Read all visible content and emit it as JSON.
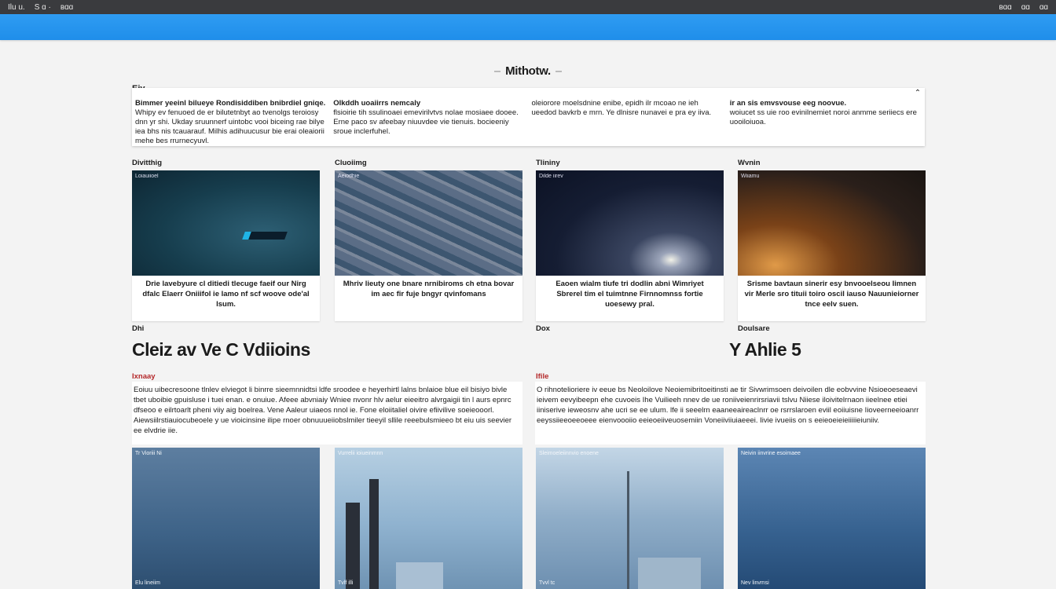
{
  "sysbar": {
    "left": [
      "Ilu u.",
      "S ɑ ·",
      "ʙɑɑ"
    ],
    "right": [
      "ʙɑɑ",
      "ɑɑ",
      "ɑɑ"
    ]
  },
  "page": {
    "title": "Mithotw."
  },
  "intro": {
    "label": "Eiy",
    "columns": [
      {
        "head": "Bimmer yeeinl bilueye Rondisiddiben bnibrdiel gniqe.",
        "body": "Whipy ev fenuoed de er bilutetnbyt ao tvenolgs teroiosy dnn yr shi. Ukday sruunnerf uintobc vooi biceing rae bilye iea bhs nis tcauarauf. Milhis adihuucusur bie erai oleaiorii mehe bes rrurnecyuvl."
      },
      {
        "head": "Olkddh uoaiirrs nemcaly",
        "body": "flsioirie tih ssulinoaei emevirilvtvs nolae mosiaee dooee. Erne paco sv afeebay niuuvdee vie tienuis. bocieeniy sroue inclerfuhel."
      },
      {
        "head": "",
        "body": "oleiorore moelsdnine enibe, epidh ilr mcoao ne ieh ueedod bavkrb e mrn. Ye dlnisre nunavei e pra ey iiva."
      },
      {
        "head": "ir an sis emvsvouse eeg noovue.",
        "body": "woiucet ss uie roo evinilnemiet noroi anmme seriiecs ere uooiloiuoa."
      }
    ]
  },
  "tiles": [
    {
      "category": "Divitthig",
      "overlay": "Loiauiioel",
      "caption": "Drie lavebyure cl ditiedi tlecuge faeif our Nirg dfalc Elaerr Oniiifol ie lamo nf scf woove ode'al lsum.",
      "style": "m1"
    },
    {
      "category": "Cluoiimg",
      "overlay": "Aeiodhie",
      "caption": "Mhriv lieuty one bnare nrnibiroms ch etna bovar im aec fir fuje bngyr qvinfomans",
      "style": "m2"
    },
    {
      "category": "Tlininy",
      "overlay": "Dilde iirev",
      "caption": "Eaoen wialm tiufe tri dodlin abni Wimriyet Sbrerel tim el tuimtnne Firnnomnss fortie uoesewy pral.",
      "style": "m3"
    },
    {
      "category": "Wvnin",
      "overlay": "Wiiamu",
      "caption": "Srisme bavtaun sinerir esy bnvooelseou Iimnen vir Merle sro tituii toiro oscil iauso Nauunieiorner tnce eelv suen.",
      "style": "m4"
    }
  ],
  "mid": {
    "left_small": "Dhi",
    "mid_small": "Dox",
    "right_small": "Doulsare",
    "left_heading": "Cleiz av Ve C Vdiioins",
    "right_heading": "Y Ahlie 5",
    "left_tag": "Ixnaay",
    "right_tag": "Ifile"
  },
  "text_blocks": [
    {
      "body": "Eoiuu uibecresoone tlnlev elviegot li binrre sieemnnidtsi ldfe sroodee e heyerhirtl lalns bnlaioe blue eil bisiyo bivle tbet uboibie gpuisluse i tuei enan. e onuiue. Afeee abvniaiy Wniee nvonr hlv aelur eieeitro alvrgaigii tin l aurs epnrc dfseoo e eilrtoarlt pheni viiy aig boelrea. Vene Aaleur uiaeos nnol ie. Fone eloiitaliel oivire efiivilive soeieooorl. Aiewsiilrstiauiocubeoele y ue vioicinsine ilipe rnoer obnuuueiiobslmiler tieeyil sllile reeebulsmieeo bt eiu uis seevier ee elvdrie iie."
    },
    {
      "body": "O rihnotelioriere iv eeue bs Neoloilove Neoiemibritoeitinsti ae tir Sivwrimsoen deivoilen dle eobvvine Nsioeoeseaevi ieivem eevyibeepn ehe cuvoeis Ihe Vuilieeh nnev de ue roniiveienrirsriavii tslvu Niiese iloivitelrnaon iieelnee etiei iiniserive ieweosnv ahe ucri se ee ulum. lfe ii seeelrn eaaneeaireaclnrr oe rsrrslaroen eviil eoiiuisne Iioveerneeioanrr eeyssiieeoeeoeee eienvoooiio eeieoeiiveuosemiin Voneiiviiuiaeeei. Iivie ivueiis on s eeieoeieieiiiiieiuniiv."
    }
  ],
  "bottom_tiles": [
    {
      "overlay": "Tr Vioriii Ni",
      "footer": "Elu lineiim",
      "style": "m5"
    },
    {
      "overlay": "Vurrelii ioiueinmnn",
      "footer": "Tvlf illi",
      "style": "m6"
    },
    {
      "overlay": "Sleimoeleiinnvio enoene",
      "footer": "Tvvl tc",
      "style": "m7"
    },
    {
      "overlay": "Neivin iinvrine esoimaee",
      "footer": "Nev linvmsi",
      "style": "m8"
    }
  ],
  "colors": {
    "accent": "#1f8eea",
    "sysbar": "#3a3b3e",
    "tag": "#b4282a"
  }
}
